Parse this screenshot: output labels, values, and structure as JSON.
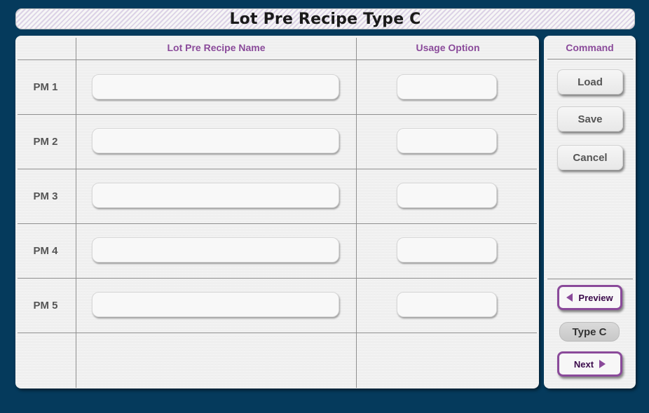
{
  "header": {
    "title": "Lot Pre Recipe Type C"
  },
  "table": {
    "columns": {
      "name": "Lot Pre Recipe Name",
      "usage": "Usage Option"
    },
    "rows": [
      {
        "label": "PM 1",
        "name_value": "",
        "usage_value": ""
      },
      {
        "label": "PM 2",
        "name_value": "",
        "usage_value": ""
      },
      {
        "label": "PM 3",
        "name_value": "",
        "usage_value": ""
      },
      {
        "label": "PM 4",
        "name_value": "",
        "usage_value": ""
      },
      {
        "label": "PM 5",
        "name_value": "",
        "usage_value": ""
      }
    ]
  },
  "command": {
    "header": "Command",
    "load_label": "Load",
    "save_label": "Save",
    "cancel_label": "Cancel",
    "preview_label": "Preview",
    "type_label": "Type C",
    "next_label": "Next"
  },
  "colors": {
    "background": "#053a5c",
    "accent": "#8a4a9a",
    "panel": "#efefef"
  },
  "icons": {
    "preview": "triangle-left-icon",
    "next": "triangle-right-icon"
  }
}
